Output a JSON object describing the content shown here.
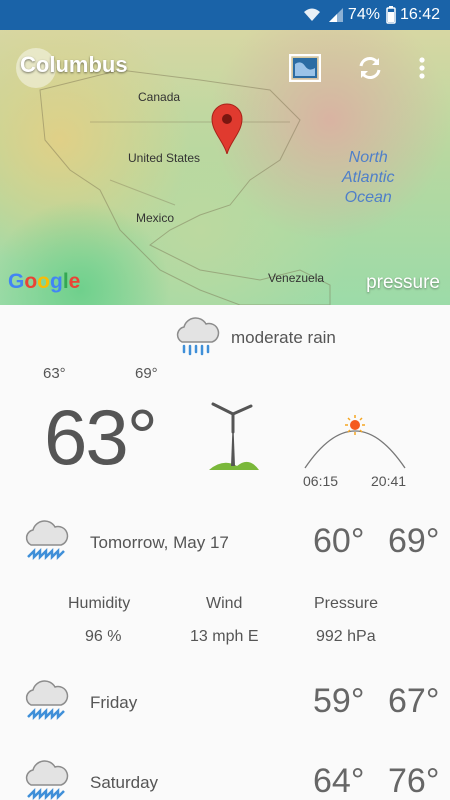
{
  "statusbar": {
    "battery": "74%",
    "time": "16:42"
  },
  "map": {
    "city": "Columbus",
    "labels": {
      "canada": "Canada",
      "us": "United States",
      "mexico": "Mexico",
      "venezuela": "Venezuela"
    },
    "ocean": [
      "North",
      "Atlantic",
      "Ocean"
    ],
    "google": "Google",
    "layer": "pressure"
  },
  "current": {
    "condition": "moderate rain",
    "low": "63°",
    "high": "69°",
    "temp": "63°",
    "sunrise": "06:15",
    "sunset": "20:41"
  },
  "tomorrow": {
    "label": "Tomorrow, May 17",
    "low": "60°",
    "high": "69°",
    "details": [
      {
        "label": "Humidity",
        "value": "96 %"
      },
      {
        "label": "Wind",
        "value": "13 mph E"
      },
      {
        "label": "Pressure",
        "value": "992 hPa"
      }
    ]
  },
  "forecast": [
    {
      "day": "Friday",
      "low": "59°",
      "high": "67°"
    },
    {
      "day": "Saturday",
      "low": "64°",
      "high": "76°"
    }
  ],
  "colors": {
    "statusbar": "#1a63a8",
    "rain": "#3f8fd8",
    "pin": "#e03a2f"
  }
}
